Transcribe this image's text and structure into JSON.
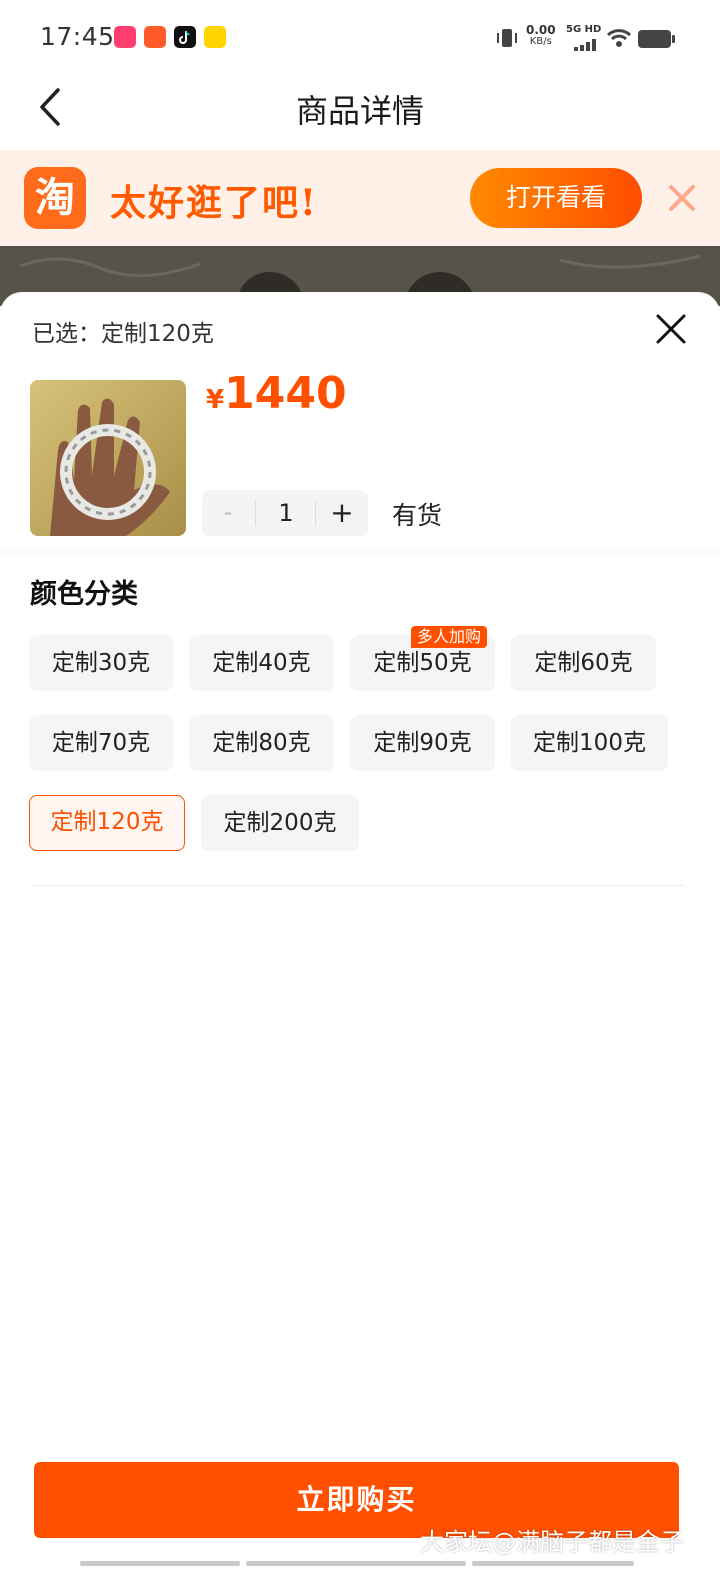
{
  "status_bar": {
    "time": "17:45",
    "net_speed": "0.00",
    "net_speed_unit": "KB/s",
    "network_type": "5G HD",
    "icons": [
      "vibrate-icon",
      "signal-icon",
      "wifi-icon",
      "battery-icon"
    ]
  },
  "header": {
    "title": "商品详情",
    "back_icon": "chevron-left-icon"
  },
  "banner": {
    "logo_text": "淘",
    "slogan": "太好逛了吧!",
    "open_button": "打开看看",
    "close_icon": "close-icon"
  },
  "sheet": {
    "selected": "已选：定制120克",
    "price_symbol": "¥",
    "price": "1440",
    "quantity": "1",
    "minus": "-",
    "plus": "+",
    "stock": "有货",
    "section_title": "颜色分类",
    "options": [
      {
        "label": "定制30克"
      },
      {
        "label": "定制40克"
      },
      {
        "label": "定制50克",
        "badge": "多人加购"
      },
      {
        "label": "定制60克"
      },
      {
        "label": "定制70克"
      },
      {
        "label": "定制80克"
      },
      {
        "label": "定制90克"
      },
      {
        "label": "定制100克"
      },
      {
        "label": "定制120克",
        "selected": true
      },
      {
        "label": "定制200克"
      }
    ]
  },
  "footer": {
    "buy_button": "立即购买",
    "watermark": "大家坛@满脑子都是金子"
  },
  "colors": {
    "accent": "#ff5000",
    "banner_bg": "#fff0e8"
  }
}
